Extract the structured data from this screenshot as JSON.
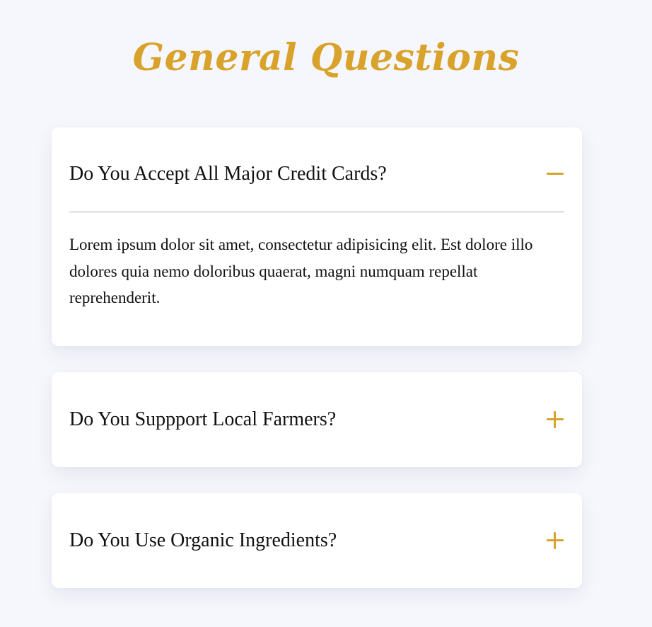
{
  "theme": {
    "accent": "#d9a22b"
  },
  "page": {
    "title": "General Questions"
  },
  "faqs": [
    {
      "question": "Do You Accept All Major Credit Cards?",
      "answer": "Lorem ipsum dolor sit amet, consectetur adipisicing elit. Est dolore illo dolores quia nemo doloribus quaerat, magni numquam repellat reprehenderit.",
      "expanded": true,
      "toggle_icon": "minus-icon"
    },
    {
      "question": "Do You Suppport Local Farmers?",
      "expanded": false,
      "toggle_icon": "plus-icon"
    },
    {
      "question": "Do You Use Organic Ingredients?",
      "expanded": false,
      "toggle_icon": "plus-icon"
    }
  ]
}
